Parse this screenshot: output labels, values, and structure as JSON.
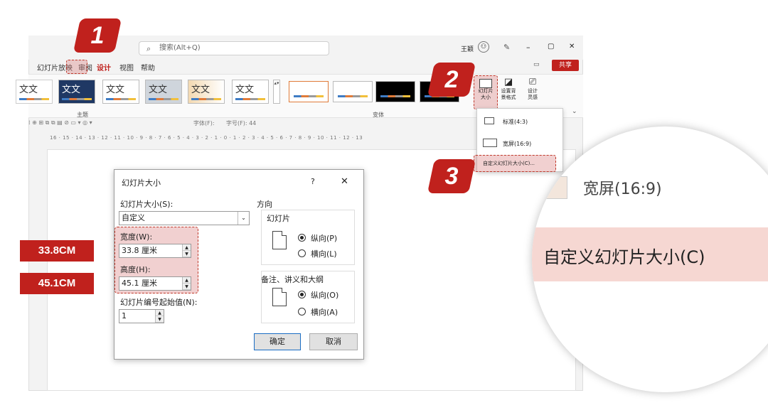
{
  "titlebar": {
    "search_placeholder": "搜索(Alt+Q)",
    "user_name": "王颖",
    "window_controls": [
      "–",
      "▢",
      "✕"
    ]
  },
  "menubar": {
    "items": [
      "幻灯片放映",
      "审阅",
      "设计",
      "视图",
      "帮助"
    ],
    "share_label": "共享"
  },
  "ribbon": {
    "theme_thumbs": [
      "文文",
      "文文",
      "文文",
      "文文",
      "文文",
      "文文"
    ],
    "group_theme_label": "主题",
    "group_variant_label": "变体",
    "slide_size_label_1": "幻灯片",
    "slide_size_label_2": "大小",
    "format_bg_label_1": "设置背",
    "format_bg_label_2": "景格式",
    "designer_label_1": "设计",
    "designer_label_2": "灵感",
    "font_label": "字体(F):",
    "fontsize_label": "字号(F): 44"
  },
  "ruler_text": "16 · 15 · 14 · 13 · 12 · 11 · 10 · 9 · 8 · 7 · 6 · 5 · 4 · 3 · 2 · 1 · 0 · 1 · 2 · 3 · 4 · 5 · 6 · 7 · 8 · 9 · 10 · 11 · 12 · 13",
  "dropdown": {
    "items": [
      "标准(4:3)",
      "宽屏(16:9)",
      "自定义幻灯片大小(C)..."
    ]
  },
  "dialog": {
    "title": "幻灯片大小",
    "help": "?",
    "close": "✕",
    "size_label": "幻灯片大小(S):",
    "size_value": "自定义",
    "width_label": "宽度(W):",
    "width_value": "33.8 厘米",
    "height_label": "高度(H):",
    "height_value": "45.1 厘米",
    "numbering_label": "幻灯片编号起始值(N):",
    "numbering_value": "1",
    "orientation_label": "方向",
    "slides_label": "幻灯片",
    "slides_portrait": "纵向(P)",
    "slides_landscape": "横向(L)",
    "notes_label": "备注、讲义和大纲",
    "notes_portrait": "纵向(O)",
    "notes_landscape": "横向(A)",
    "ok": "确定",
    "cancel": "取消"
  },
  "annotations": {
    "width_tag": "33.8CM",
    "height_tag": "45.1CM",
    "step1": "1",
    "step2": "2",
    "step3": "3"
  },
  "magnifier": {
    "line1": "宽屏(16:9)",
    "line2": "自定义幻灯片大小(C)"
  },
  "colors": {
    "accent_red": "#c0211d",
    "highlight_fill": "#f6d7d2"
  }
}
